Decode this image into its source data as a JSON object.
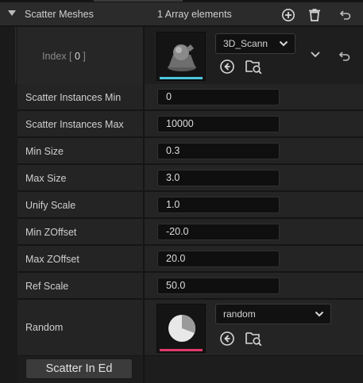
{
  "header": {
    "title": "Scatter Meshes",
    "count": "1 Array elements",
    "icons": [
      "add-element-icon",
      "delete-icon",
      "reset-icon"
    ]
  },
  "index": {
    "label_prefix": "Index [ ",
    "number": "0",
    "label_suffix": " ]",
    "mesh_combo": "3D_Scann",
    "thumbnail_color": "#4ac8e0",
    "icons": [
      "browse-arrow-icon",
      "find-in-browser-icon",
      "chevron-down-icon",
      "reset-icon"
    ]
  },
  "fields": [
    {
      "label": "Scatter Instances Min",
      "value": "0"
    },
    {
      "label": "Scatter Instances Max",
      "value": "10000"
    },
    {
      "label": "Min Size",
      "value": "0.3"
    },
    {
      "label": "Max Size",
      "value": "3.0"
    },
    {
      "label": "Unify Scale",
      "value": "1.0"
    },
    {
      "label": "Min ZOffset",
      "value": "-20.0"
    },
    {
      "label": "Max ZOffset",
      "value": "20.0"
    },
    {
      "label": "Ref Scale",
      "value": "50.0"
    }
  ],
  "random": {
    "label": "Random",
    "combo": "random",
    "thumbnail_color": "#e03a6a",
    "icons": [
      "browse-arrow-icon",
      "find-in-browser-icon"
    ]
  },
  "button": {
    "label": "Scatter In Ed"
  },
  "colors": {
    "panel_bg": "#242424",
    "field_bg": "#0f0f0f",
    "mesh_accent": "#4ac8e0",
    "curve_accent": "#e03a6a"
  }
}
